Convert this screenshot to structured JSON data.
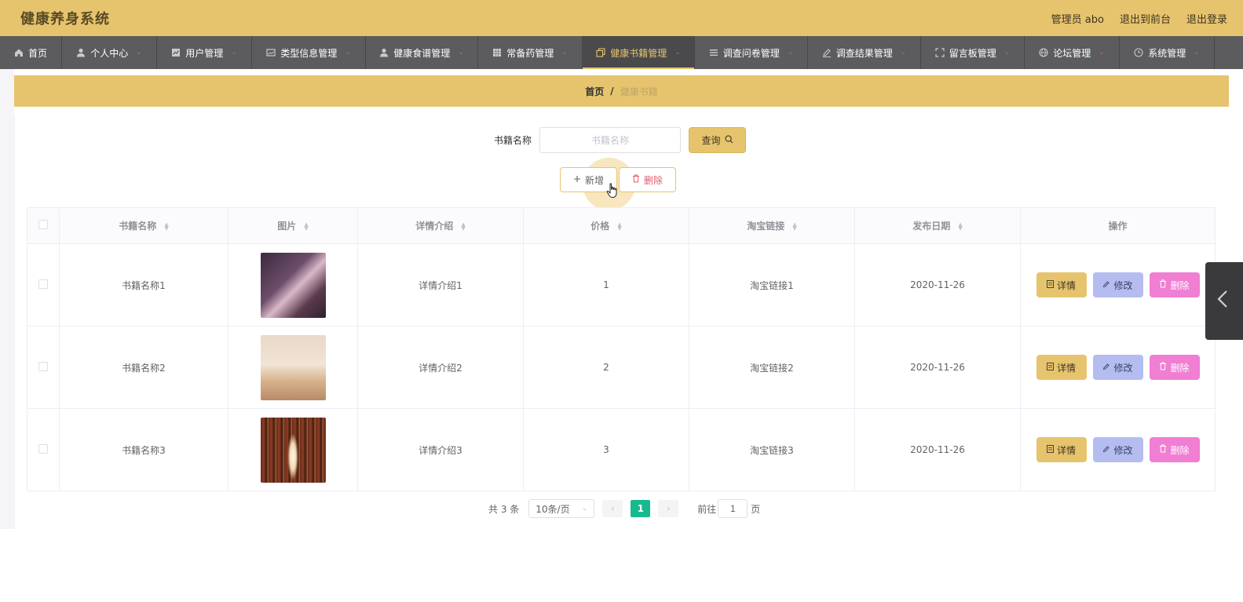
{
  "header": {
    "title": "健康养身系统",
    "admin": "管理员 abo",
    "to_front": "退出到前台",
    "logout": "退出登录"
  },
  "nav": {
    "items": [
      {
        "label": "首页",
        "icon": "home-icon",
        "has_caret": false
      },
      {
        "label": "个人中心",
        "icon": "user-icon",
        "has_caret": true
      },
      {
        "label": "用户管理",
        "icon": "chart-icon",
        "has_caret": true
      },
      {
        "label": "类型信息管理",
        "icon": "image-icon",
        "has_caret": true
      },
      {
        "label": "健康食谱管理",
        "icon": "user-icon",
        "has_caret": true
      },
      {
        "label": "常备药管理",
        "icon": "grid-icon",
        "has_caret": true
      },
      {
        "label": "健康书籍管理",
        "icon": "copy-icon",
        "has_caret": true,
        "active": true
      },
      {
        "label": "调查问卷管理",
        "icon": "list-icon",
        "has_caret": true
      },
      {
        "label": "调查结果管理",
        "icon": "edit-icon",
        "has_caret": true
      },
      {
        "label": "留言板管理",
        "icon": "fullscreen-icon",
        "has_caret": true
      },
      {
        "label": "论坛管理",
        "icon": "globe-icon",
        "has_caret": true
      },
      {
        "label": "系统管理",
        "icon": "clock-icon",
        "has_caret": true
      }
    ]
  },
  "breadcrumb": {
    "home": "首页",
    "separator": "/",
    "current": "健康书籍"
  },
  "search": {
    "label": "书籍名称",
    "placeholder": "书籍名称",
    "value": "",
    "query_button": "查询"
  },
  "actions": {
    "add": "新增",
    "delete": "删除"
  },
  "table": {
    "columns": [
      "书籍名称",
      "图片",
      "详情介绍",
      "价格",
      "淘宝链接",
      "发布日期",
      "操作"
    ],
    "rows": [
      {
        "name": "书籍名称1",
        "intro": "详情介绍1",
        "price": "1",
        "link": "淘宝链接1",
        "date": "2020-11-26"
      },
      {
        "name": "书籍名称2",
        "intro": "详情介绍2",
        "price": "2",
        "link": "淘宝链接2",
        "date": "2020-11-26"
      },
      {
        "name": "书籍名称3",
        "intro": "详情介绍3",
        "price": "3",
        "link": "淘宝链接3",
        "date": "2020-11-26"
      }
    ],
    "row_actions": {
      "detail": "详情",
      "edit": "修改",
      "delete": "删除"
    }
  },
  "pagination": {
    "total": "共 3 条",
    "page_size": "10条/页",
    "current_page": "1",
    "goto_prefix": "前往",
    "goto_value": "1",
    "goto_suffix": "页"
  },
  "colors": {
    "accent": "#e6c46e",
    "nav_bg": "#5c5b5e",
    "active_page": "#18b98e",
    "danger": "#e05b6f",
    "edit_btn": "#b4bcf0",
    "delete_btn": "#f07ed2"
  }
}
